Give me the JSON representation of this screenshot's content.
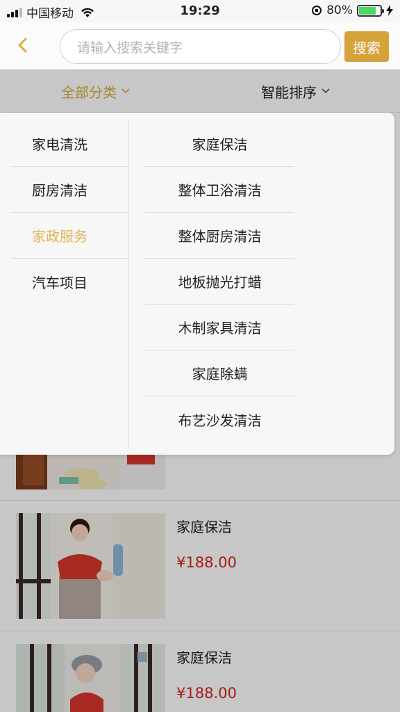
{
  "status_bar": {
    "carrier": "中国移动",
    "time": "19:29",
    "battery": "80%",
    "battery_level": 0.8
  },
  "nav": {
    "back_icon": "chevron-left-icon",
    "search_placeholder": "请输入搜索关键字",
    "search_button": "搜索"
  },
  "filters": {
    "category": "全部分类",
    "sort": "智能排序"
  },
  "categories": [
    {
      "label": "家电清洗",
      "active": false
    },
    {
      "label": "厨房清洁",
      "active": false
    },
    {
      "label": "家政服务",
      "active": true
    },
    {
      "label": "汽车项目",
      "active": false
    }
  ],
  "subcategories": [
    "家庭保洁",
    "整体卫浴清洁",
    "整体厨房清洁",
    "地板抛光打蜡",
    "木制家具清洁",
    "家庭除螨",
    "布艺沙发清洁"
  ],
  "products": [
    {
      "name": "家庭保洁",
      "price": "¥188.00"
    },
    {
      "name": "家庭保洁",
      "price": "¥188.00"
    }
  ],
  "colors": {
    "accent": "#d9ae3a",
    "price": "#d9231c",
    "battery": "#4cd964"
  }
}
